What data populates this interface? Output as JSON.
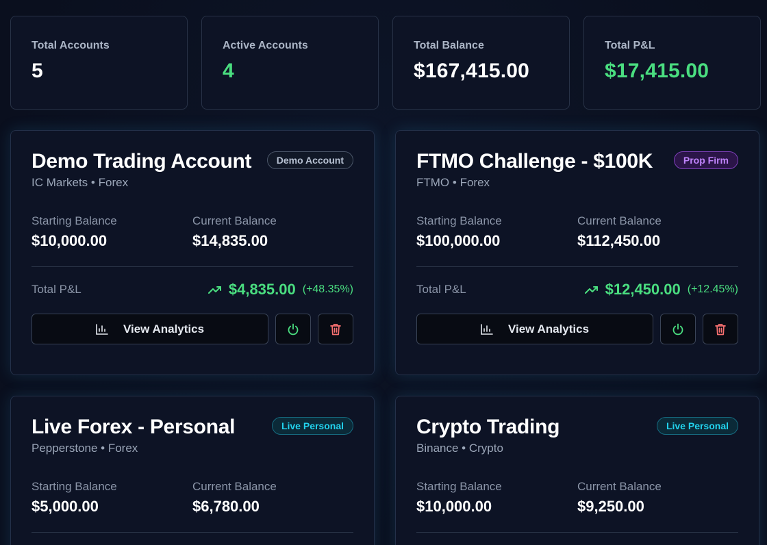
{
  "stats": [
    {
      "label": "Total Accounts",
      "value": "5",
      "tone": "white"
    },
    {
      "label": "Active Accounts",
      "value": "4",
      "tone": "green"
    },
    {
      "label": "Total Balance",
      "value": "$167,415.00",
      "tone": "white"
    },
    {
      "label": "Total P&L",
      "value": "$17,415.00",
      "tone": "green"
    }
  ],
  "labels": {
    "starting_balance": "Starting Balance",
    "current_balance": "Current Balance",
    "total_pnl": "Total P&L",
    "view_analytics": "View Analytics"
  },
  "accounts": [
    {
      "title": "Demo Trading Account",
      "broker": "IC Markets",
      "market": "Forex",
      "badge": "Demo Account",
      "badge_type": "demo",
      "starting_balance": "$10,000.00",
      "current_balance": "$14,835.00",
      "pnl": "$4,835.00",
      "pnl_pct": "(+48.35%)"
    },
    {
      "title": "FTMO Challenge - $100K",
      "broker": "FTMO",
      "market": "Forex",
      "badge": "Prop Firm",
      "badge_type": "prop",
      "starting_balance": "$100,000.00",
      "current_balance": "$112,450.00",
      "pnl": "$12,450.00",
      "pnl_pct": "(+12.45%)"
    },
    {
      "title": "Live Forex - Personal",
      "broker": "Pepperstone",
      "market": "Forex",
      "badge": "Live Personal",
      "badge_type": "live",
      "starting_balance": "$5,000.00",
      "current_balance": "$6,780.00"
    },
    {
      "title": "Crypto Trading",
      "broker": "Binance",
      "market": "Crypto",
      "badge": "Live Personal",
      "badge_type": "live",
      "starting_balance": "$10,000.00",
      "current_balance": "$9,250.00"
    }
  ],
  "separator": "•",
  "colors": {
    "background": "#0a0f1e",
    "card": "#0d1325",
    "positive": "#4ade80",
    "danger": "#f87171",
    "prop_badge": "#c084fc",
    "live_badge": "#22d3ee"
  },
  "icons": {
    "stats": "bar-chart-icon",
    "trend": "trending-up-icon",
    "toggle": "power-icon",
    "delete": "trash-icon"
  }
}
